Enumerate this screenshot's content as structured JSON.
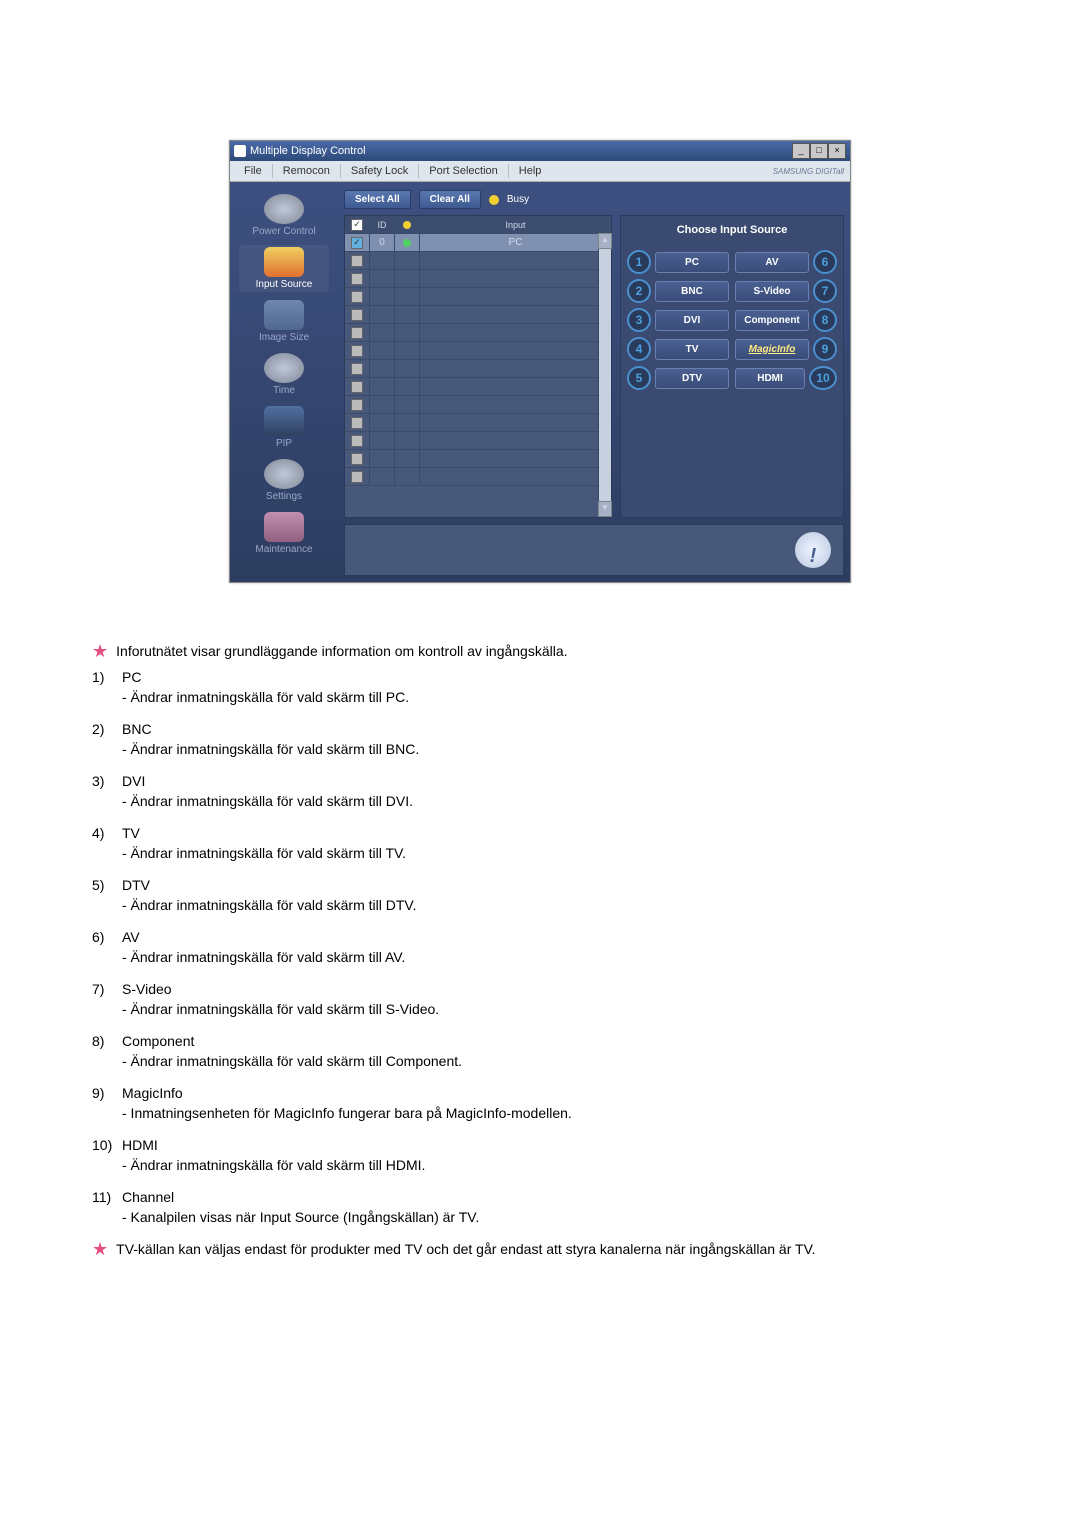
{
  "window": {
    "title": "Multiple Display Control",
    "menus": [
      "File",
      "Remocon",
      "Safety Lock",
      "Port Selection",
      "Help"
    ],
    "brand": "SAMSUNG DIGITall"
  },
  "sidebar_items": [
    {
      "label": "Power Control",
      "active": false
    },
    {
      "label": "Input Source",
      "active": true
    },
    {
      "label": "Image Size",
      "active": false
    },
    {
      "label": "Time",
      "active": false
    },
    {
      "label": "PIP",
      "active": false
    },
    {
      "label": "Settings",
      "active": false
    },
    {
      "label": "Maintenance",
      "active": false
    }
  ],
  "toolbar": {
    "select_all": "Select All",
    "clear_all": "Clear All",
    "busy": "Busy"
  },
  "grid": {
    "headers": {
      "id": "ID",
      "input": "Input"
    },
    "first_row": {
      "id": "0",
      "input": "PC"
    }
  },
  "source_panel": {
    "title": "Choose Input Source",
    "left": [
      {
        "n": "1",
        "label": "PC"
      },
      {
        "n": "2",
        "label": "BNC"
      },
      {
        "n": "3",
        "label": "DVI"
      },
      {
        "n": "4",
        "label": "TV"
      },
      {
        "n": "5",
        "label": "DTV"
      }
    ],
    "right": [
      {
        "n": "6",
        "label": "AV"
      },
      {
        "n": "7",
        "label": "S-Video"
      },
      {
        "n": "8",
        "label": "Component"
      },
      {
        "n": "9",
        "label": "MagicInfo",
        "magic": true
      },
      {
        "n": "10",
        "label": "HDMI"
      }
    ]
  },
  "notes": {
    "intro": "Inforutnätet visar grundläggande information om kontroll av ingångskälla.",
    "footer": "TV-källan kan väljas endast för produkter med TV och det går endast att styra kanalerna när ingångskällan är TV."
  },
  "items": [
    {
      "n": "1)",
      "title": "PC",
      "sub": "- Ändrar inmatningskälla för vald skärm till PC."
    },
    {
      "n": "2)",
      "title": "BNC",
      "sub": "- Ändrar inmatningskälla för vald skärm till BNC."
    },
    {
      "n": "3)",
      "title": "DVI",
      "sub": "- Ändrar inmatningskälla för vald skärm till DVI."
    },
    {
      "n": "4)",
      "title": "TV",
      "sub": "- Ändrar inmatningskälla för vald skärm till TV."
    },
    {
      "n": "5)",
      "title": "DTV",
      "sub": "- Ändrar inmatningskälla för vald skärm till DTV."
    },
    {
      "n": "6)",
      "title": "AV",
      "sub": "- Ändrar inmatningskälla för vald skärm till AV."
    },
    {
      "n": "7)",
      "title": "S-Video",
      "sub": "- Ändrar inmatningskälla för vald skärm till S-Video."
    },
    {
      "n": "8)",
      "title": "Component",
      "sub": "- Ändrar inmatningskälla för vald skärm till Component."
    },
    {
      "n": "9)",
      "title": "MagicInfo",
      "sub": "- Inmatningsenheten för MagicInfo fungerar bara på MagicInfo-modellen."
    },
    {
      "n": "10)",
      "title": "HDMI",
      "sub": "- Ändrar inmatningskälla för vald skärm till HDMI."
    },
    {
      "n": "11)",
      "title": "Channel",
      "sub": "- Kanalpilen visas när Input Source (Ingångskällan) är TV."
    }
  ]
}
